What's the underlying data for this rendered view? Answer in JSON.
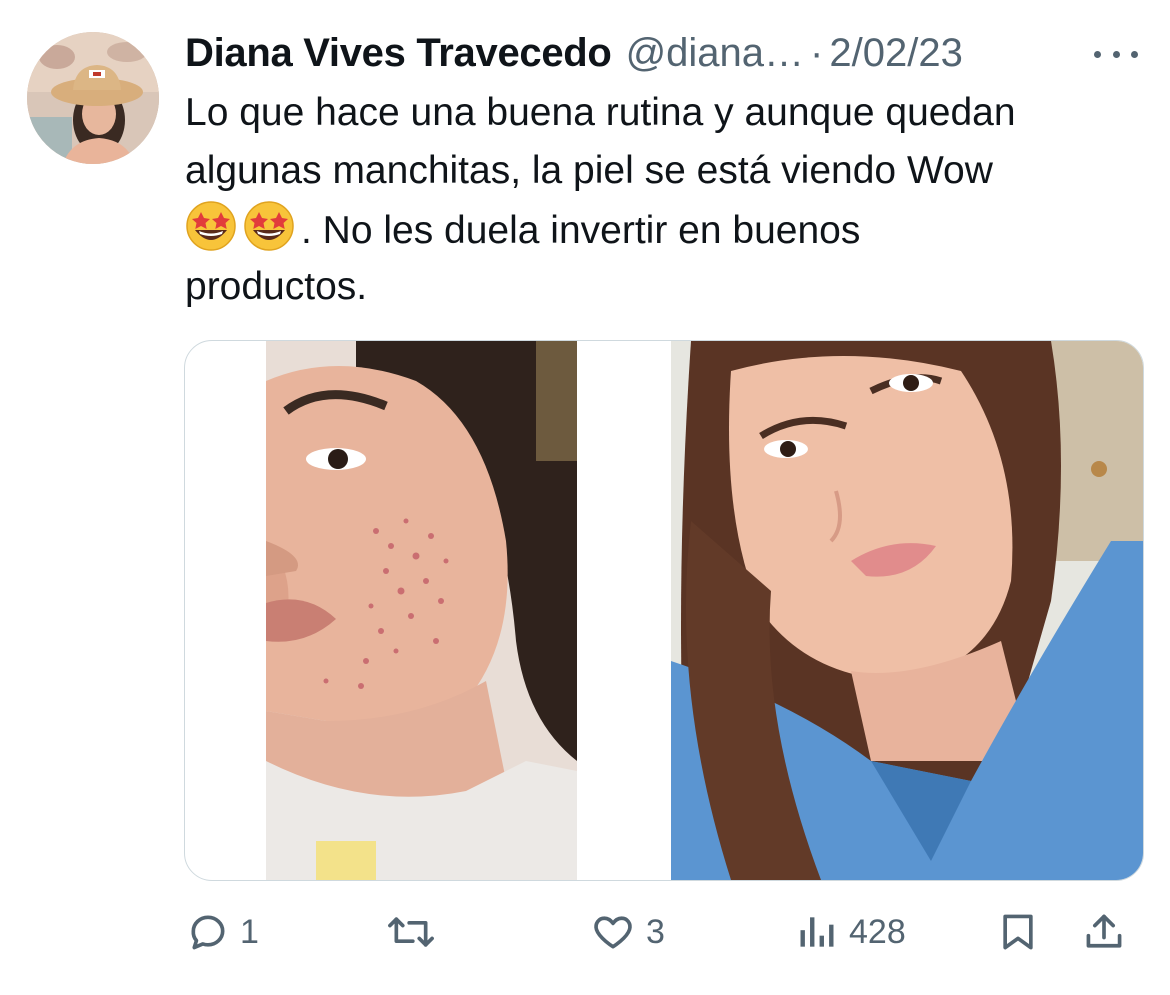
{
  "author": {
    "display_name": "Diana Vives Travecedo",
    "handle": "@diana…",
    "separator": "·",
    "date": "2/02/23",
    "avatar_icon": "profile-avatar"
  },
  "more_icon": "more-horizontal-icon",
  "text": {
    "line1": "Lo que hace una buena rutina y aunque quedan",
    "line2": "algunas manchitas, la piel se está viendo Wow",
    "line3_after_emoji": ". No les duela invertir en buenos",
    "line4": "productos.",
    "emoji": [
      "🤩",
      "🤩"
    ]
  },
  "media": {
    "photos": [
      "before-photo",
      "after-photo"
    ]
  },
  "actions": {
    "reply": {
      "icon": "reply-icon",
      "count": "1"
    },
    "retweet": {
      "icon": "retweet-icon",
      "count": ""
    },
    "like": {
      "icon": "heart-icon",
      "count": "3"
    },
    "views": {
      "icon": "views-icon",
      "count": "428"
    },
    "bookmark": {
      "icon": "bookmark-icon"
    },
    "share": {
      "icon": "share-icon"
    }
  },
  "colors": {
    "text_primary": "#0f1419",
    "text_secondary": "#536471",
    "border": "#cfd9de"
  }
}
